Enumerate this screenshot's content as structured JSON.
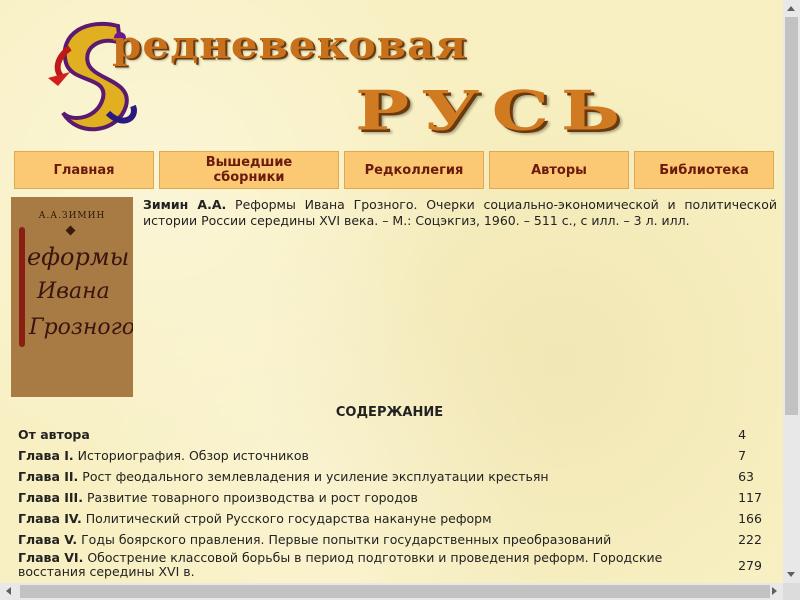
{
  "logo": {
    "line1": "редневековая",
    "line2": "РУСЬ"
  },
  "nav": {
    "items": [
      {
        "label": "Главная"
      },
      {
        "label": "Вышедшие сборники"
      },
      {
        "label": "Редколлегия"
      },
      {
        "label": "Авторы"
      },
      {
        "label": "Библиотека"
      }
    ]
  },
  "book": {
    "cover_author": "А.А.ЗИМИН",
    "cover_title_1": "еформы",
    "cover_title_2": "Ивана",
    "cover_title_3": "Грозного",
    "author": "Зимин А.А.",
    "description": "Реформы Ивана Грозного. Очерки социально-экономической и политической истории России середины XVI века. – М.: Соцэкгиз, 1960. – 511 с., с илл. – 3 л. илл."
  },
  "contents": {
    "title": "СОДЕРЖАНИЕ",
    "rows": [
      {
        "chapter": "От автора",
        "text": "",
        "page": "4"
      },
      {
        "chapter": "Глава I.",
        "text": "Историография. Обзор источников",
        "page": "7"
      },
      {
        "chapter": "Глава II.",
        "text": "Рост феодального землевладения и усиление эксплуатации крестьян",
        "page": "63"
      },
      {
        "chapter": "Глава III.",
        "text": "Развитие товарного производства и рост городов",
        "page": "117"
      },
      {
        "chapter": "Глава IV.",
        "text": "Политический строй Русского государства накануне реформ",
        "page": "166"
      },
      {
        "chapter": "Глава V.",
        "text": "Годы боярского правления. Первые попытки государственных преобразований",
        "page": "222"
      },
      {
        "chapter": "Глава VI.",
        "text": "Обострение классовой борьбы в период подготовки и проведения реформ. Городские восстания середины XVI в.",
        "page": "279"
      }
    ]
  },
  "colors": {
    "nav_bg": "#fbc873",
    "nav_text": "#6b1a0e",
    "logo": "#c8711d"
  }
}
